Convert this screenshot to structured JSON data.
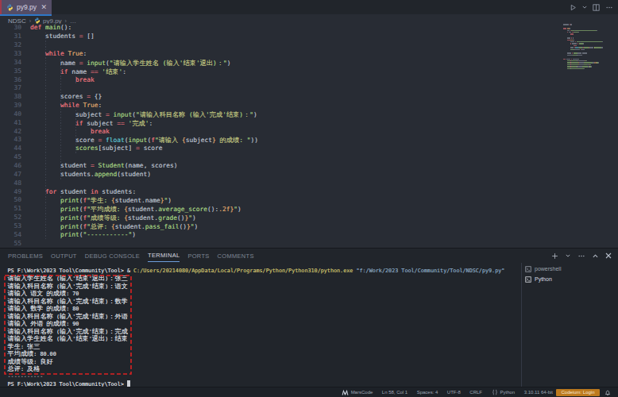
{
  "tabbar": {
    "tab_label": "py9.py",
    "close_label": "✕"
  },
  "breadcrumb": {
    "folder": "NDSC",
    "file": "py9.py",
    "symbol": "…"
  },
  "editor": {
    "lines": [
      {
        "n": 30,
        "indent": 0,
        "tk": [
          {
            "t": "def",
            "c": "kw"
          },
          {
            "t": " ",
            "c": "tx"
          },
          {
            "t": "main",
            "c": "fn"
          },
          {
            "t": "():",
            "c": "pu"
          }
        ]
      },
      {
        "n": 31,
        "indent": 1,
        "tk": [
          {
            "t": "    ",
            "c": "tx"
          },
          {
            "t": "students",
            "c": "tx"
          },
          {
            "t": " ",
            "c": "tx"
          },
          {
            "t": "=",
            "c": "op"
          },
          {
            "t": " ",
            "c": "tx"
          },
          {
            "t": "[]",
            "c": "pu"
          }
        ]
      },
      {
        "n": 32,
        "indent": 0,
        "tk": []
      },
      {
        "n": 33,
        "indent": 1,
        "tk": [
          {
            "t": "    ",
            "c": "tx"
          },
          {
            "t": "while",
            "c": "kw"
          },
          {
            "t": " ",
            "c": "tx"
          },
          {
            "t": "True",
            "c": "or"
          },
          {
            "t": ":",
            "c": "pu"
          }
        ]
      },
      {
        "n": 34,
        "indent": 2,
        "tk": [
          {
            "t": "        ",
            "c": "tx"
          },
          {
            "t": "name",
            "c": "tx"
          },
          {
            "t": " ",
            "c": "tx"
          },
          {
            "t": "=",
            "c": "op"
          },
          {
            "t": " ",
            "c": "tx"
          },
          {
            "t": "input",
            "c": "fn"
          },
          {
            "t": "(",
            "c": "pu"
          },
          {
            "t": "\"请输入学生姓名 (输入'结束'退出)：\"",
            "c": "str"
          },
          {
            "t": ")",
            "c": "pu"
          }
        ]
      },
      {
        "n": 35,
        "indent": 2,
        "tk": [
          {
            "t": "        ",
            "c": "tx"
          },
          {
            "t": "if",
            "c": "kw"
          },
          {
            "t": " ",
            "c": "tx"
          },
          {
            "t": "name",
            "c": "tx"
          },
          {
            "t": " ",
            "c": "tx"
          },
          {
            "t": "==",
            "c": "op"
          },
          {
            "t": " ",
            "c": "tx"
          },
          {
            "t": "'结束'",
            "c": "str"
          },
          {
            "t": ":",
            "c": "pu"
          }
        ]
      },
      {
        "n": 36,
        "indent": 3,
        "tk": [
          {
            "t": "            ",
            "c": "tx"
          },
          {
            "t": "break",
            "c": "kw"
          }
        ]
      },
      {
        "n": 37,
        "indent": 0,
        "tk": []
      },
      {
        "n": 38,
        "indent": 2,
        "tk": [
          {
            "t": "        ",
            "c": "tx"
          },
          {
            "t": "scores",
            "c": "tx"
          },
          {
            "t": " ",
            "c": "tx"
          },
          {
            "t": "=",
            "c": "op"
          },
          {
            "t": " ",
            "c": "tx"
          },
          {
            "t": "{}",
            "c": "pu"
          }
        ]
      },
      {
        "n": 39,
        "indent": 2,
        "tk": [
          {
            "t": "        ",
            "c": "tx"
          },
          {
            "t": "while",
            "c": "kw"
          },
          {
            "t": " ",
            "c": "tx"
          },
          {
            "t": "True",
            "c": "or"
          },
          {
            "t": ":",
            "c": "pu"
          }
        ]
      },
      {
        "n": 40,
        "indent": 3,
        "tk": [
          {
            "t": "            ",
            "c": "tx"
          },
          {
            "t": "subject",
            "c": "tx"
          },
          {
            "t": " ",
            "c": "tx"
          },
          {
            "t": "=",
            "c": "op"
          },
          {
            "t": " ",
            "c": "tx"
          },
          {
            "t": "input",
            "c": "fn"
          },
          {
            "t": "(",
            "c": "pu"
          },
          {
            "t": "\"请输入科目名称 (输入'完成'结束)：\"",
            "c": "str"
          },
          {
            "t": ")",
            "c": "pu"
          }
        ]
      },
      {
        "n": 41,
        "indent": 3,
        "tk": [
          {
            "t": "            ",
            "c": "tx"
          },
          {
            "t": "if",
            "c": "kw"
          },
          {
            "t": " ",
            "c": "tx"
          },
          {
            "t": "subject",
            "c": "tx"
          },
          {
            "t": " ",
            "c": "tx"
          },
          {
            "t": "==",
            "c": "op"
          },
          {
            "t": " ",
            "c": "tx"
          },
          {
            "t": "'完成'",
            "c": "str"
          },
          {
            "t": ":",
            "c": "pu"
          }
        ]
      },
      {
        "n": 42,
        "indent": 4,
        "tk": [
          {
            "t": "                ",
            "c": "tx"
          },
          {
            "t": "break",
            "c": "kw"
          }
        ]
      },
      {
        "n": 43,
        "indent": 3,
        "tk": [
          {
            "t": "            ",
            "c": "tx"
          },
          {
            "t": "score",
            "c": "tx"
          },
          {
            "t": " ",
            "c": "tx"
          },
          {
            "t": "=",
            "c": "op"
          },
          {
            "t": " ",
            "c": "tx"
          },
          {
            "t": "float",
            "c": "tl"
          },
          {
            "t": "(",
            "c": "pu"
          },
          {
            "t": "input",
            "c": "fn"
          },
          {
            "t": "(",
            "c": "pu"
          },
          {
            "t": "f",
            "c": "kw"
          },
          {
            "t": "\"请输入 ",
            "c": "str"
          },
          {
            "t": "{",
            "c": "br"
          },
          {
            "t": "subject",
            "c": "tx"
          },
          {
            "t": "}",
            "c": "br"
          },
          {
            "t": " 的成绩: \"",
            "c": "str"
          },
          {
            "t": "))",
            "c": "pu"
          }
        ]
      },
      {
        "n": 44,
        "indent": 3,
        "tk": [
          {
            "t": "            ",
            "c": "tx"
          },
          {
            "t": "scores",
            "c": "fn"
          },
          {
            "t": "[",
            "c": "pu"
          },
          {
            "t": "subject",
            "c": "tx"
          },
          {
            "t": "]",
            "c": "pu"
          },
          {
            "t": " ",
            "c": "tx"
          },
          {
            "t": "=",
            "c": "op"
          },
          {
            "t": " ",
            "c": "tx"
          },
          {
            "t": "score",
            "c": "tx"
          }
        ]
      },
      {
        "n": 45,
        "indent": 0,
        "tk": []
      },
      {
        "n": 46,
        "indent": 2,
        "tk": [
          {
            "t": "        ",
            "c": "tx"
          },
          {
            "t": "student",
            "c": "tx"
          },
          {
            "t": " ",
            "c": "tx"
          },
          {
            "t": "=",
            "c": "op"
          },
          {
            "t": " ",
            "c": "tx"
          },
          {
            "t": "Student",
            "c": "fn"
          },
          {
            "t": "(",
            "c": "pu"
          },
          {
            "t": "name",
            "c": "tx"
          },
          {
            "t": ",",
            "c": "pu"
          },
          {
            "t": " ",
            "c": "tx"
          },
          {
            "t": "scores",
            "c": "tx"
          },
          {
            "t": ")",
            "c": "pu"
          }
        ]
      },
      {
        "n": 47,
        "indent": 2,
        "tk": [
          {
            "t": "        ",
            "c": "tx"
          },
          {
            "t": "students",
            "c": "tx"
          },
          {
            "t": ".",
            "c": "pu"
          },
          {
            "t": "append",
            "c": "fn"
          },
          {
            "t": "(",
            "c": "pu"
          },
          {
            "t": "student",
            "c": "tx"
          },
          {
            "t": ")",
            "c": "pu"
          }
        ]
      },
      {
        "n": 48,
        "indent": 0,
        "tk": []
      },
      {
        "n": 49,
        "indent": 1,
        "tk": [
          {
            "t": "    ",
            "c": "tx"
          },
          {
            "t": "for",
            "c": "kw"
          },
          {
            "t": " ",
            "c": "tx"
          },
          {
            "t": "student",
            "c": "tx"
          },
          {
            "t": " ",
            "c": "tx"
          },
          {
            "t": "in",
            "c": "kw"
          },
          {
            "t": " ",
            "c": "tx"
          },
          {
            "t": "students",
            "c": "tx"
          },
          {
            "t": ":",
            "c": "pu"
          }
        ]
      },
      {
        "n": 50,
        "indent": 2,
        "tk": [
          {
            "t": "        ",
            "c": "tx"
          },
          {
            "t": "print",
            "c": "fn"
          },
          {
            "t": "(",
            "c": "pu"
          },
          {
            "t": "f",
            "c": "kw"
          },
          {
            "t": "\"学生: ",
            "c": "str"
          },
          {
            "t": "{",
            "c": "br"
          },
          {
            "t": "student.name",
            "c": "tx"
          },
          {
            "t": "}",
            "c": "br"
          },
          {
            "t": "\"",
            "c": "str"
          },
          {
            "t": ")",
            "c": "pu"
          }
        ]
      },
      {
        "n": 51,
        "indent": 2,
        "tk": [
          {
            "t": "        ",
            "c": "tx"
          },
          {
            "t": "print",
            "c": "fn"
          },
          {
            "t": "(",
            "c": "pu"
          },
          {
            "t": "f",
            "c": "kw"
          },
          {
            "t": "\"平均成绩: ",
            "c": "str"
          },
          {
            "t": "{",
            "c": "br"
          },
          {
            "t": "student.",
            "c": "tx"
          },
          {
            "t": "average_score",
            "c": "fn"
          },
          {
            "t": "():",
            "c": "pu"
          },
          {
            "t": ".2f",
            "c": "or"
          },
          {
            "t": "}",
            "c": "br"
          },
          {
            "t": "\"",
            "c": "str"
          },
          {
            "t": ")",
            "c": "pu"
          }
        ]
      },
      {
        "n": 52,
        "indent": 2,
        "tk": [
          {
            "t": "        ",
            "c": "tx"
          },
          {
            "t": "print",
            "c": "fn"
          },
          {
            "t": "(",
            "c": "pu"
          },
          {
            "t": "f",
            "c": "kw"
          },
          {
            "t": "\"成绩等级: ",
            "c": "str"
          },
          {
            "t": "{",
            "c": "br"
          },
          {
            "t": "student.",
            "c": "tx"
          },
          {
            "t": "grade",
            "c": "fn"
          },
          {
            "t": "()",
            "c": "pu"
          },
          {
            "t": "}",
            "c": "br"
          },
          {
            "t": "\"",
            "c": "str"
          },
          {
            "t": ")",
            "c": "pu"
          }
        ]
      },
      {
        "n": 53,
        "indent": 2,
        "tk": [
          {
            "t": "        ",
            "c": "tx"
          },
          {
            "t": "print",
            "c": "fn"
          },
          {
            "t": "(",
            "c": "pu"
          },
          {
            "t": "f",
            "c": "kw"
          },
          {
            "t": "\"总评: ",
            "c": "str"
          },
          {
            "t": "{",
            "c": "br"
          },
          {
            "t": "student.",
            "c": "tx"
          },
          {
            "t": "pass_fail",
            "c": "fn"
          },
          {
            "t": "()",
            "c": "pu"
          },
          {
            "t": "}",
            "c": "br"
          },
          {
            "t": "\"",
            "c": "str"
          },
          {
            "t": ")",
            "c": "pu"
          }
        ]
      },
      {
        "n": 54,
        "indent": 2,
        "tk": [
          {
            "t": "        ",
            "c": "tx"
          },
          {
            "t": "print",
            "c": "fn"
          },
          {
            "t": "(",
            "c": "pu"
          },
          {
            "t": "\"-----------\"",
            "c": "str"
          },
          {
            "t": ")",
            "c": "pu"
          }
        ]
      },
      {
        "n": 55,
        "indent": 0,
        "tk": []
      }
    ],
    "guides": [
      {
        "level": 1,
        "from": 1,
        "to": 24
      },
      {
        "level": 2,
        "from": 4,
        "to": 17
      },
      {
        "level": 2,
        "from": 20,
        "to": 24
      },
      {
        "level": 3,
        "from": 6,
        "to": 6
      },
      {
        "level": 3,
        "from": 10,
        "to": 14
      },
      {
        "level": 4,
        "from": 12,
        "to": 12
      }
    ]
  },
  "panel": {
    "tabs": [
      "PROBLEMS",
      "OUTPUT",
      "DEBUG CONSOLE",
      "TERMINAL",
      "PORTS",
      "COMMENTS"
    ],
    "active_tab": "TERMINAL"
  },
  "terminal": {
    "lines": [
      {
        "tk": [
          {
            "t": "PS F:\\Work\\2023 Tool\\Community\\Tool> ",
            "c": "tw"
          },
          {
            "t": "& ",
            "c": "tw"
          },
          {
            "t": "C:/Users/20214080/AppData/Local/Programs/Python/Python310/python.exe",
            "c": "ty"
          },
          {
            "t": " \"f:/Work/2023 Tool/Community/Tool/NDSC/py9.py\"",
            "c": "tk"
          }
        ]
      },
      {
        "tk": [
          {
            "t": "请输入学生姓名 (输入'结束'退出)：张三",
            "c": "tw"
          }
        ]
      },
      {
        "tk": [
          {
            "t": "请输入科目名称 (输入'完成'结束)：语文",
            "c": "tw"
          }
        ]
      },
      {
        "tk": [
          {
            "t": "请输入 语文 的成绩: 70",
            "c": "tw"
          }
        ]
      },
      {
        "tk": [
          {
            "t": "请输入科目名称 (输入'完成'结束)：数学",
            "c": "tw"
          }
        ]
      },
      {
        "tk": [
          {
            "t": "请输入 数学 的成绩: 80",
            "c": "tw"
          }
        ]
      },
      {
        "tk": [
          {
            "t": "请输入科目名称 (输入'完成'结束)：外语",
            "c": "tw"
          }
        ]
      },
      {
        "tk": [
          {
            "t": "请输入 外语 的成绩: 90",
            "c": "tw"
          }
        ]
      },
      {
        "tk": [
          {
            "t": "请输入科目名称 (输入'完成'结束)：完成",
            "c": "tw"
          }
        ]
      },
      {
        "tk": [
          {
            "t": "请输入学生姓名 (输入'结束'退出)：结束",
            "c": "tw"
          }
        ]
      },
      {
        "tk": [
          {
            "t": "学生: 张三",
            "c": "tw"
          }
        ]
      },
      {
        "tk": [
          {
            "t": "平均成绩: 80.00",
            "c": "tw"
          }
        ]
      },
      {
        "tk": [
          {
            "t": "成绩等级: 良好",
            "c": "tw"
          }
        ]
      },
      {
        "tk": [
          {
            "t": "总评: 及格",
            "c": "tw"
          }
        ]
      },
      {
        "tk": [
          {
            "t": "-----------",
            "c": "td"
          }
        ]
      },
      {
        "tk": [
          {
            "t": "PS F:\\Work\\2023 Tool\\Community\\Tool> ",
            "c": "tw"
          }
        ],
        "cursor": true
      }
    ],
    "sessions": [
      {
        "label": "powershell",
        "active": false
      },
      {
        "label": "Python",
        "active": true
      }
    ]
  },
  "statusbar": {
    "items": [
      {
        "name": "marscode-status",
        "icon": "marscode",
        "label": "MarsCode"
      },
      {
        "name": "cursor-position",
        "label": "Ln 58, Col 1"
      },
      {
        "name": "indentation",
        "label": "Spaces: 4"
      },
      {
        "name": "encoding",
        "label": "UTF-8"
      },
      {
        "name": "eol-sequence",
        "label": "CRLF"
      },
      {
        "name": "language-mode",
        "icon": "braces",
        "label": "Python"
      },
      {
        "name": "python-interpreter",
        "label": "3.10.11 64-bit"
      },
      {
        "name": "codeium-login",
        "label": "Codeium: Login",
        "style": "pill"
      },
      {
        "name": "notifications-bell",
        "icon": "bell"
      }
    ]
  },
  "annotation": {
    "color": "#dd2222",
    "style": "dashed"
  }
}
